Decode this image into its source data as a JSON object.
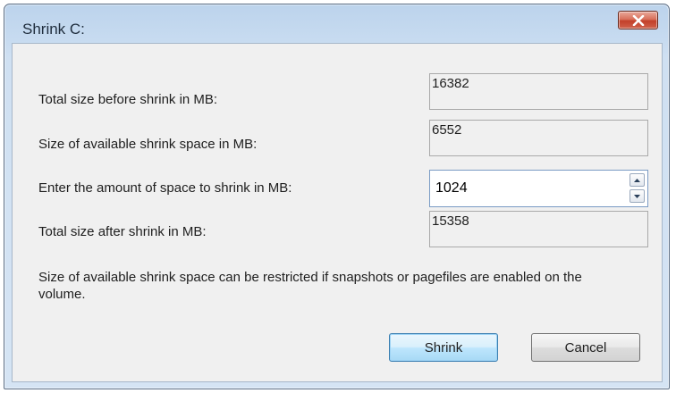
{
  "window": {
    "title": "Shrink C:"
  },
  "fields": [
    {
      "label": "Total size before shrink in MB:",
      "value": "16382"
    },
    {
      "label": "Size of available shrink space in MB:",
      "value": "6552"
    },
    {
      "label": "Enter the amount of space to shrink in MB:",
      "value": "1024"
    },
    {
      "label": "Total size after shrink in MB:",
      "value": "15358"
    }
  ],
  "note": "Size of available shrink space can be restricted if snapshots or pagefiles are enabled on the volume.",
  "buttons": {
    "shrink": "Shrink",
    "cancel": "Cancel"
  },
  "icons": {
    "close": "close-icon",
    "spin_up": "arrow-up-icon",
    "spin_down": "arrow-down-icon"
  },
  "colors": {
    "close_button": "#c2402a",
    "default_button": "#bee6fd",
    "title_frame": "#c7dbf0"
  }
}
